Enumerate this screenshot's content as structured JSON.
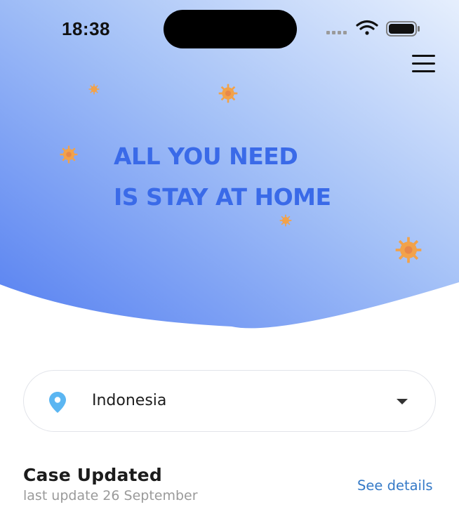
{
  "status_bar": {
    "time": "18:38",
    "icons": [
      "signal-icon",
      "wifi-icon",
      "battery-icon"
    ]
  },
  "header": {
    "menu_icon": "hamburger-menu-icon",
    "headline_line1": "ALL YOU NEED",
    "headline_line2": "IS STAY AT HOME",
    "gradient_colors": [
      "#5b86f2",
      "#e4eefd"
    ],
    "headline_color": "#3a6ae8",
    "virus_color": "#f2a24a"
  },
  "country_selector": {
    "icon": "location-pin-icon",
    "selected_value": "Indonesia",
    "dropdown_icon": "dropdown-arrow-icon"
  },
  "case_section": {
    "title": "Case Updated",
    "subtitle": "last update 26 September",
    "link_label": "See details",
    "link_color": "#3479c7"
  }
}
